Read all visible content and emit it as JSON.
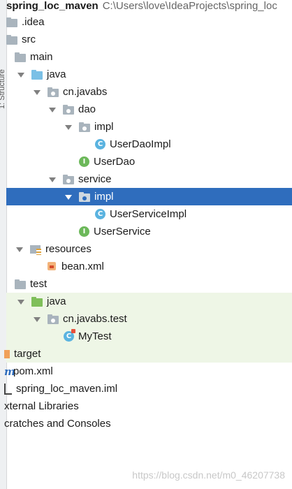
{
  "project": {
    "name": "spring_loc_maven",
    "path": "C:\\Users\\love\\IdeaProjects\\spring_loc"
  },
  "side_panel_label": "1: Structure",
  "tree": [
    {
      "label": ".idea",
      "icon": "folder-icon"
    },
    {
      "label": "src",
      "icon": "folder-icon"
    },
    {
      "label": "main",
      "icon": "folder-icon"
    },
    {
      "label": "java",
      "icon": "source-folder-icon"
    },
    {
      "label": "cn.javabs",
      "icon": "package-icon"
    },
    {
      "label": "dao",
      "icon": "package-icon"
    },
    {
      "label": "impl",
      "icon": "package-icon"
    },
    {
      "label": "UserDaoImpl",
      "icon": "class-icon",
      "glyph": "C"
    },
    {
      "label": "UserDao",
      "icon": "interface-icon",
      "glyph": "I"
    },
    {
      "label": "service",
      "icon": "package-icon"
    },
    {
      "label": "impl",
      "icon": "package-icon",
      "selected": true
    },
    {
      "label": "UserServiceImpl",
      "icon": "class-icon",
      "glyph": "C"
    },
    {
      "label": "UserService",
      "icon": "interface-icon",
      "glyph": "I"
    },
    {
      "label": "resources",
      "icon": "resources-folder-icon"
    },
    {
      "label": "bean.xml",
      "icon": "xml-file-icon"
    },
    {
      "label": "test",
      "icon": "folder-icon"
    },
    {
      "label": "java",
      "icon": "test-source-folder-icon"
    },
    {
      "label": "cn.javabs.test",
      "icon": "package-icon"
    },
    {
      "label": "MyTest",
      "icon": "test-class-icon",
      "glyph": "C"
    },
    {
      "label": "target",
      "icon": "excluded-folder-icon"
    },
    {
      "label": "pom.xml",
      "icon": "maven-icon",
      "glyph": "m"
    },
    {
      "label": "spring_loc_maven.iml",
      "icon": "iml-file-icon"
    },
    {
      "label": "xternal Libraries",
      "icon": "none"
    },
    {
      "label": "cratches and Consoles",
      "icon": "none"
    }
  ],
  "watermark": "https://blog.csdn.net/m0_46207738",
  "colors": {
    "selection": "#2f6dbd",
    "test_highlight": "#eef6e6",
    "source_folder": "#7bc0e6",
    "test_folder": "#7fbf5a"
  }
}
